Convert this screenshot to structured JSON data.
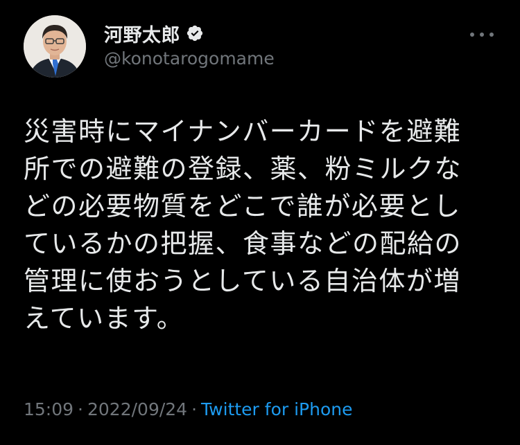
{
  "author": {
    "display_name": "河野太郎",
    "handle": "@konotarogomame",
    "verified": true,
    "avatar_icon": "profile-photo"
  },
  "more_button": {
    "icon": "more-horizontal-icon"
  },
  "tweet": {
    "lines": [
      "災害時にマイナンバーカードを避難",
      "所での避難の登録、薬、粉ミルクな",
      "どの必要物質をどこで誰が必要とし",
      "ているかの把握、食事などの配給の",
      "管理に使おうとしている自治体が増",
      "えています。"
    ]
  },
  "meta": {
    "time": "15:09",
    "separator": "·",
    "date": "2022/09/24",
    "source": "Twitter for iPhone"
  },
  "colors": {
    "background": "#000000",
    "text": "#e7e9ea",
    "secondary": "#71767b",
    "link": "#1d9bf0",
    "verified_badge": "#e7e9ea"
  }
}
